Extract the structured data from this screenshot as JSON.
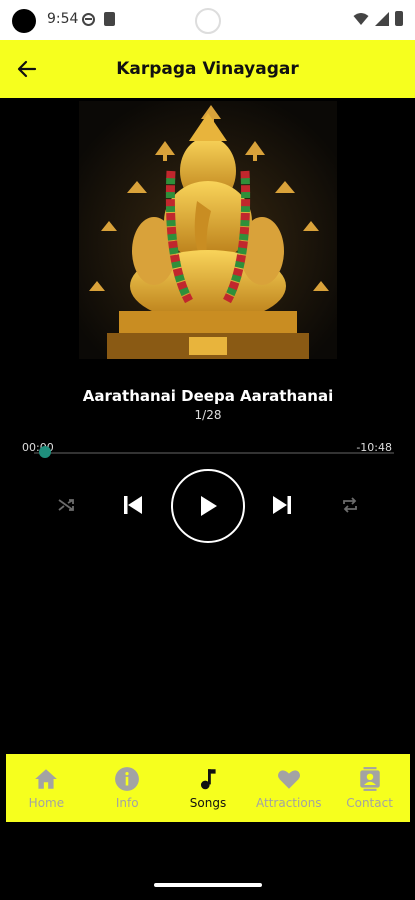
{
  "status_bar": {
    "time": "9:54"
  },
  "app_bar": {
    "title": "Karpaga Vinayagar",
    "back_icon": "arrow-left-icon"
  },
  "player": {
    "song_title": "Aarathanai Deepa Aarathanai",
    "track_position": "1/28",
    "elapsed": "00:00",
    "remaining": "-10:48",
    "progress_fraction": 0.03,
    "colors": {
      "seek_thumb": "#1f8f7d",
      "accent": "#f6ff1e"
    },
    "controls": [
      "shuffle-icon",
      "skip-previous-icon",
      "play-icon",
      "skip-next-icon",
      "repeat-icon"
    ]
  },
  "bottom_nav": {
    "items": [
      {
        "label": "Home",
        "icon": "home-icon",
        "active": false
      },
      {
        "label": "Info",
        "icon": "info-icon",
        "active": false
      },
      {
        "label": "Songs",
        "icon": "music-note-icon",
        "active": true
      },
      {
        "label": "Attractions",
        "icon": "heart-icon",
        "active": false
      },
      {
        "label": "Contact",
        "icon": "contact-card-icon",
        "active": false
      }
    ]
  }
}
